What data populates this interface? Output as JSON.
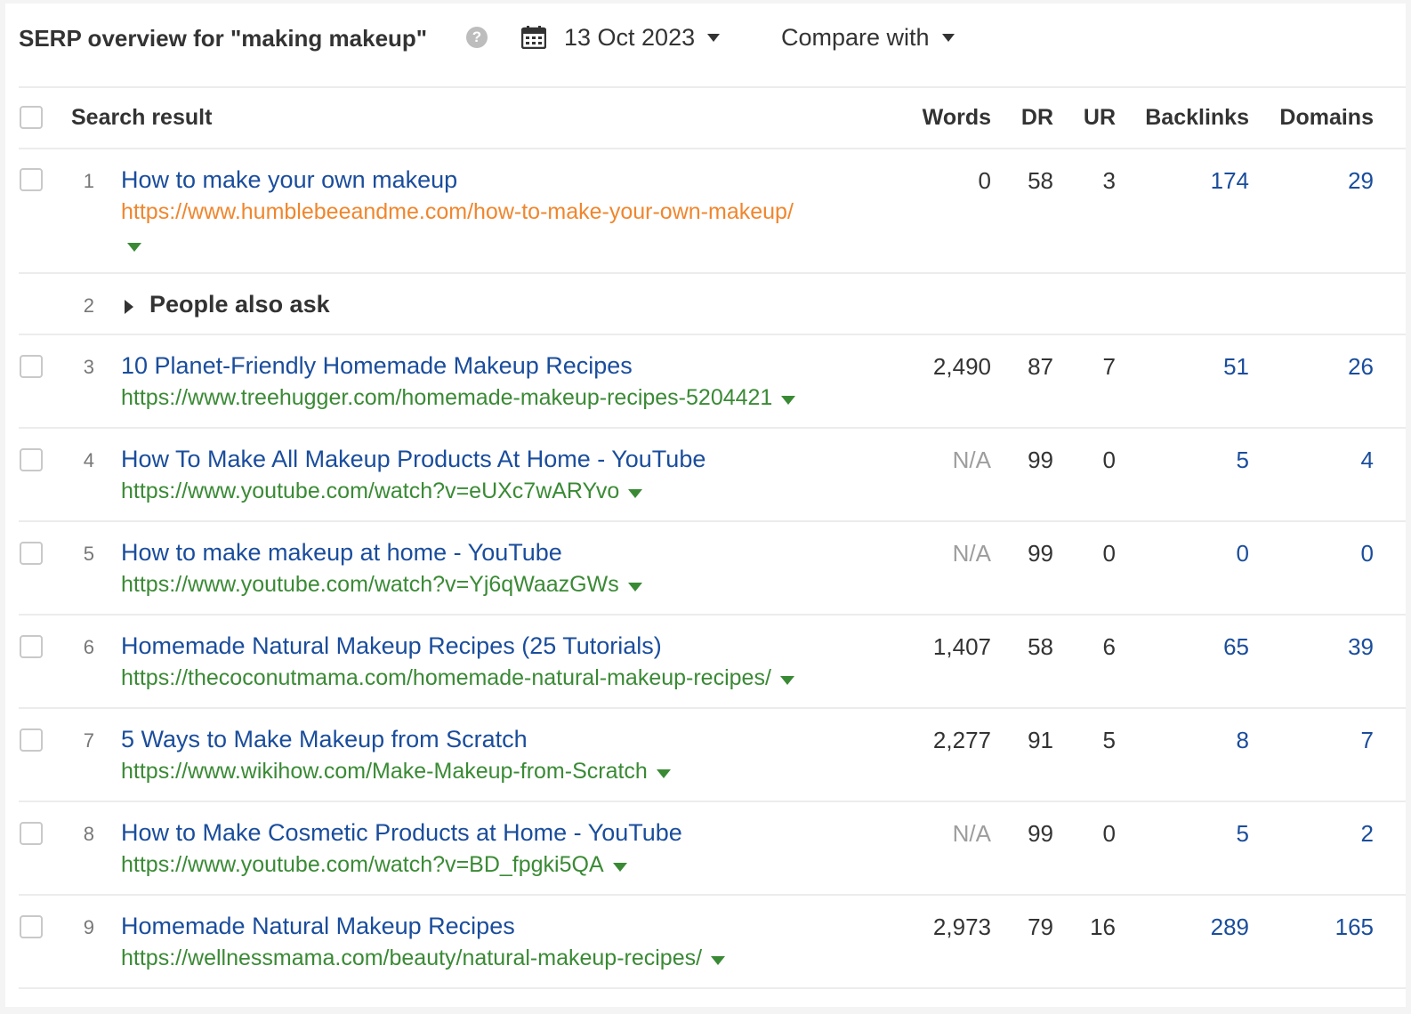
{
  "header": {
    "title": "SERP overview for \"making makeup\"",
    "help_icon": "question-circle-icon",
    "date": "13 Oct 2023",
    "compare_label": "Compare with"
  },
  "table": {
    "columns": {
      "result": "Search result",
      "words": "Words",
      "dr": "DR",
      "ur": "UR",
      "backlinks": "Backlinks",
      "domains": "Domains"
    },
    "rows": [
      {
        "pos": "1",
        "title": "How to make your own makeup",
        "url": "https://www.humblebeeandme.com/how-to-make-your-own-makeup/",
        "words": "0",
        "dr": "58",
        "ur": "3",
        "backlinks": "174",
        "domains": "29"
      },
      {
        "pos": "2",
        "paa": "People also ask"
      },
      {
        "pos": "3",
        "title": "10 Planet-Friendly Homemade Makeup Recipes",
        "url": "https://www.treehugger.com/homemade-makeup-recipes-5204421",
        "words": "2,490",
        "dr": "87",
        "ur": "7",
        "backlinks": "51",
        "domains": "26"
      },
      {
        "pos": "4",
        "title": "How To Make All Makeup Products At Home - YouTube",
        "url": "https://www.youtube.com/watch?v=eUXc7wARYvo",
        "words": "N/A",
        "dr": "99",
        "ur": "0",
        "backlinks": "5",
        "domains": "4"
      },
      {
        "pos": "5",
        "title": "How to make makeup at home - YouTube",
        "url": "https://www.youtube.com/watch?v=Yj6qWaazGWs",
        "words": "N/A",
        "dr": "99",
        "ur": "0",
        "backlinks": "0",
        "domains": "0"
      },
      {
        "pos": "6",
        "title": "Homemade Natural Makeup Recipes (25 Tutorials)",
        "url": "https://thecoconutmama.com/homemade-natural-makeup-recipes/",
        "words": "1,407",
        "dr": "58",
        "ur": "6",
        "backlinks": "65",
        "domains": "39"
      },
      {
        "pos": "7",
        "title": "5 Ways to Make Makeup from Scratch",
        "url": "https://www.wikihow.com/Make-Makeup-from-Scratch",
        "words": "2,277",
        "dr": "91",
        "ur": "5",
        "backlinks": "8",
        "domains": "7"
      },
      {
        "pos": "8",
        "title": "How to Make Cosmetic Products at Home - YouTube",
        "url": "https://www.youtube.com/watch?v=BD_fpgki5QA",
        "words": "N/A",
        "dr": "99",
        "ur": "0",
        "backlinks": "5",
        "domains": "2"
      },
      {
        "pos": "9",
        "title": "Homemade Natural Makeup Recipes",
        "url": "https://wellnessmama.com/beauty/natural-makeup-recipes/",
        "words": "2,973",
        "dr": "79",
        "ur": "16",
        "backlinks": "289",
        "domains": "165"
      }
    ]
  },
  "colors": {
    "title_link": "#1a4d9c",
    "url": "#3a8a35",
    "url_visited": "#f0862d",
    "na": "#9d9d9d"
  }
}
